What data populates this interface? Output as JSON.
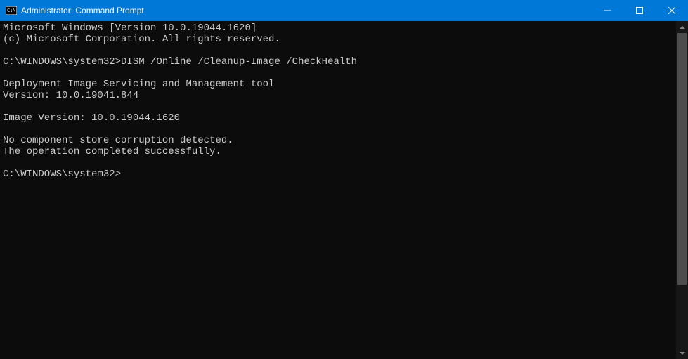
{
  "window": {
    "title": "Administrator: Command Prompt"
  },
  "terminal": {
    "lines": [
      "Microsoft Windows [Version 10.0.19044.1620]",
      "(c) Microsoft Corporation. All rights reserved.",
      "",
      "C:\\WINDOWS\\system32>DISM /Online /Cleanup-Image /CheckHealth",
      "",
      "Deployment Image Servicing and Management tool",
      "Version: 10.0.19041.844",
      "",
      "Image Version: 10.0.19044.1620",
      "",
      "No component store corruption detected.",
      "The operation completed successfully.",
      "",
      "C:\\WINDOWS\\system32>"
    ]
  }
}
